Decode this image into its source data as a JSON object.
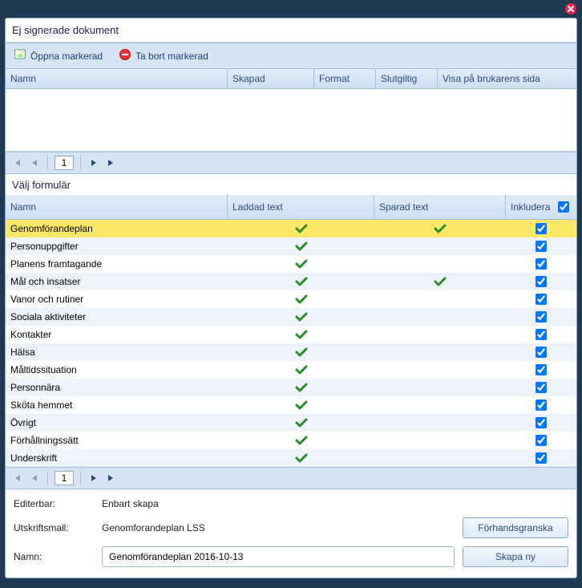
{
  "window": {
    "title_docs": "Ej signerade dokument",
    "title_forms": "Välj formulär"
  },
  "toolbar": {
    "open_label": "Öppna markerad",
    "delete_label": "Ta bort markerad"
  },
  "docs_columns": {
    "c1": "Namn",
    "c2": "Skapad",
    "c3": "Format",
    "c4": "Slutgiltig",
    "c5": "Visa på brukarens sida"
  },
  "pager": {
    "page": "1"
  },
  "forms_columns": {
    "c1": "Namn",
    "c2": "Laddad text",
    "c3": "Sparad text",
    "c4": "Inkludera"
  },
  "form_rows": [
    {
      "name": "Genomförandeplan",
      "loaded": true,
      "saved": true,
      "include": true,
      "selected": true
    },
    {
      "name": "Personuppgifter",
      "loaded": true,
      "saved": false,
      "include": true
    },
    {
      "name": "Planens framtagande",
      "loaded": true,
      "saved": false,
      "include": true
    },
    {
      "name": "Mål och insatser",
      "loaded": true,
      "saved": true,
      "include": true
    },
    {
      "name": "Vanor och rutiner",
      "loaded": true,
      "saved": false,
      "include": true
    },
    {
      "name": "Sociala aktiviteter",
      "loaded": true,
      "saved": false,
      "include": true
    },
    {
      "name": "Kontakter",
      "loaded": true,
      "saved": false,
      "include": true
    },
    {
      "name": "Hälsa",
      "loaded": true,
      "saved": false,
      "include": true
    },
    {
      "name": "Måltidssituation",
      "loaded": true,
      "saved": false,
      "include": true
    },
    {
      "name": "Personnära",
      "loaded": true,
      "saved": false,
      "include": true
    },
    {
      "name": "Sköta hemmet",
      "loaded": true,
      "saved": false,
      "include": true
    },
    {
      "name": "Övrigt",
      "loaded": true,
      "saved": false,
      "include": true
    },
    {
      "name": "Förhållningssätt",
      "loaded": true,
      "saved": false,
      "include": true
    },
    {
      "name": "Underskrift",
      "loaded": true,
      "saved": false,
      "include": true
    }
  ],
  "footer": {
    "editable_label": "Editerbar:",
    "editable_value": "Enbart skapa",
    "template_label": "Utskriftsmall:",
    "template_value": "Genomforandeplan LSS",
    "name_label": "Namn:",
    "name_value": "Genomförandeplan 2016-10-13",
    "preview_label": "Förhandsgranska",
    "create_label": "Skapa ny"
  },
  "include_all": true
}
